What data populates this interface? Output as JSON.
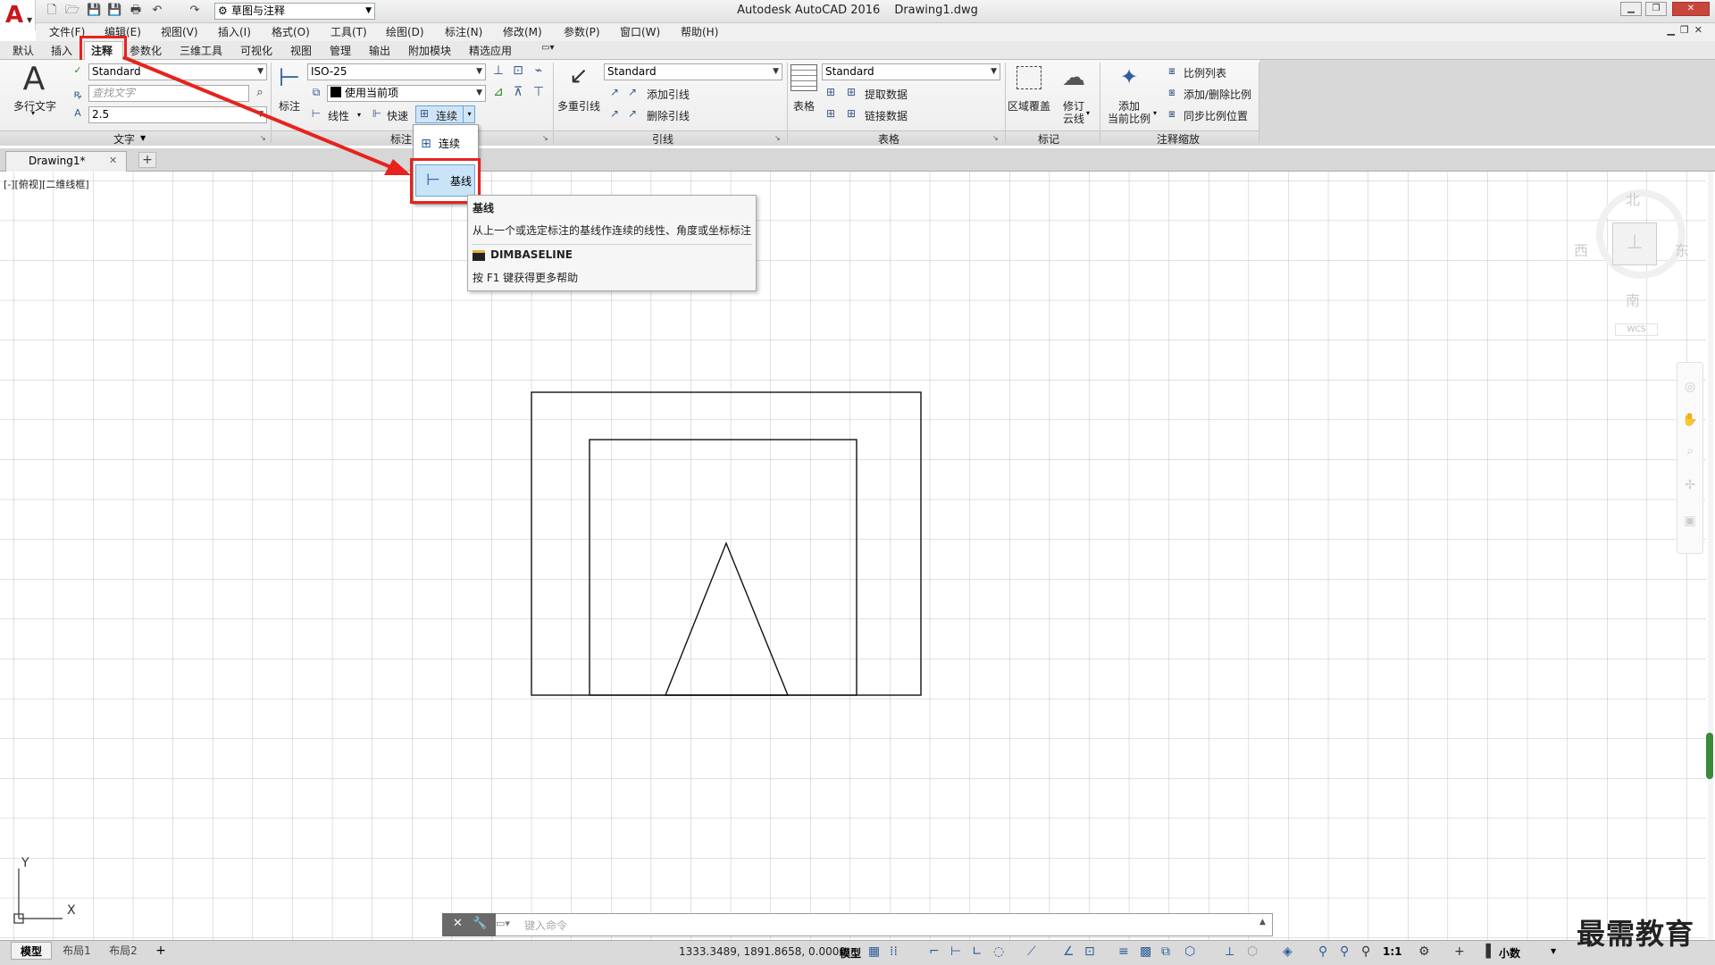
{
  "app": {
    "title": "Autodesk AutoCAD 2016",
    "file": "Drawing1.dwg",
    "workspace": "草图与注释"
  },
  "menu": [
    "文件(F)",
    "编辑(E)",
    "视图(V)",
    "插入(I)",
    "格式(O)",
    "工具(T)",
    "绘图(D)",
    "标注(N)",
    "修改(M)",
    "参数(P)",
    "窗口(W)",
    "帮助(H)"
  ],
  "ribbon_tabs": [
    "默认",
    "插入",
    "注释",
    "参数化",
    "三维工具",
    "可视化",
    "视图",
    "管理",
    "输出",
    "附加模块",
    "精选应用"
  ],
  "active_tab": "注释",
  "panels": {
    "text": {
      "title": "文字",
      "big_button": "多行文字",
      "style": "Standard",
      "find_placeholder": "查找文字",
      "height": "2.5"
    },
    "dimensions": {
      "title": "标注",
      "big_button": "标注",
      "style": "ISO-25",
      "layer": "使用当前项",
      "linear": "线性",
      "quick": "快速",
      "continue": "连续"
    },
    "leaders": {
      "title": "引线",
      "big_button": "多重引线",
      "style": "Standard",
      "add": "添加引线",
      "remove": "删除引线"
    },
    "tables": {
      "title": "表格",
      "big_button": "表格",
      "style": "Standard",
      "extract": "提取数据",
      "link": "链接数据"
    },
    "markup": {
      "title": "标记",
      "wipeout": "区域覆盖",
      "revcloud_1": "修订",
      "revcloud_2": "云线"
    },
    "scaling": {
      "title": "注释缩放",
      "add_1": "添加",
      "add_2": "当前比例",
      "scale_list": "比例列表",
      "add_delete": "添加/删除比例",
      "sync": "同步比例位置"
    }
  },
  "dropdown": {
    "item1": "连续",
    "item2": "基线"
  },
  "tooltip": {
    "title": "基线",
    "desc": "从上一个或选定标注的基线作连续的线性、角度或坐标标注",
    "command": "DIMBASELINE",
    "help": "按 F1 键获得更多帮助"
  },
  "document_tab": "Drawing1*",
  "viewport_label": "[-][俯视][二维线框]",
  "viewcube": {
    "north": "北",
    "south": "南",
    "east": "东",
    "west": "西",
    "wcs": "WCS"
  },
  "ucs": {
    "x": "X",
    "y": "Y"
  },
  "command_placeholder": "键入命令",
  "layout_tabs": [
    "模型",
    "布局1",
    "布局2"
  ],
  "status": {
    "coords": "1333.3489, 1891.8658, 0.0000",
    "model": "模型",
    "scale": "1:1",
    "units": "小数"
  },
  "watermark": "最需教育"
}
